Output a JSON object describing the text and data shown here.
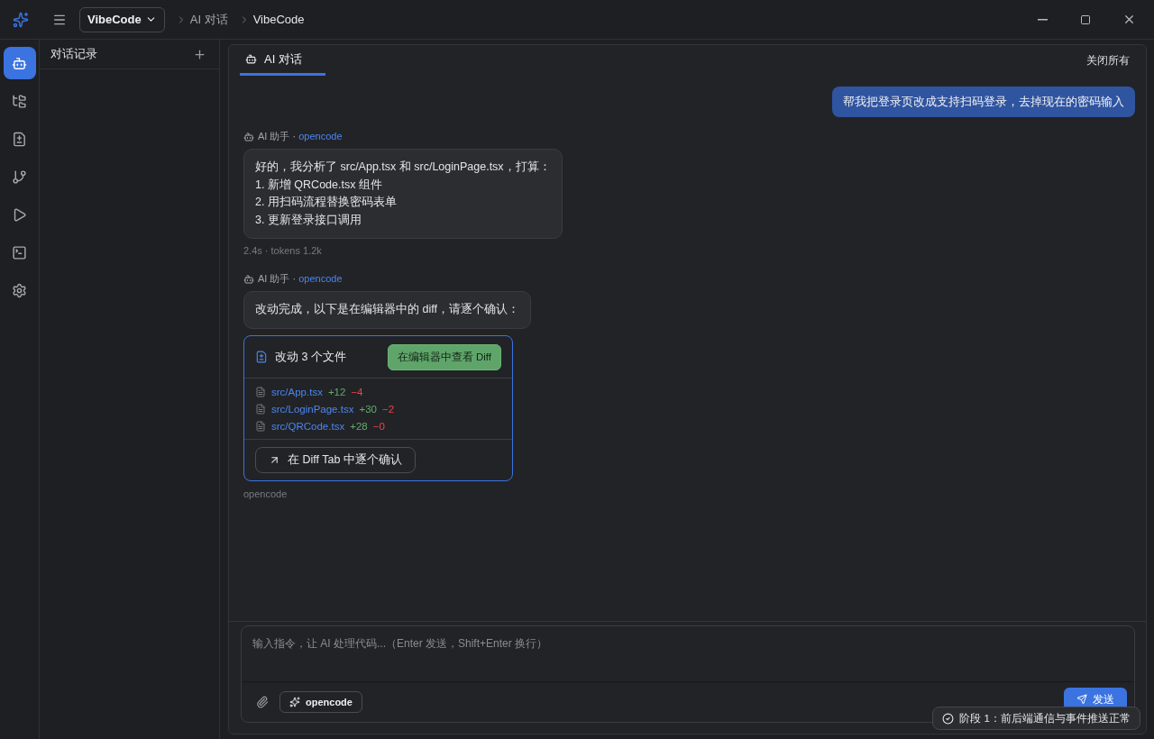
{
  "titlebar": {
    "project": "VibeCode",
    "breadcrumbs": [
      "AI 对话",
      "VibeCode"
    ]
  },
  "activity_bar": [
    {
      "kind": "bot",
      "selected": true
    },
    {
      "kind": "tree",
      "selected": false
    },
    {
      "kind": "diff",
      "selected": false
    },
    {
      "kind": "branch",
      "selected": false
    },
    {
      "kind": "run",
      "selected": false
    },
    {
      "kind": "terminal",
      "selected": false
    },
    {
      "kind": "settings",
      "selected": false
    }
  ],
  "sidebar": {
    "title": "对话记录"
  },
  "tabs": [
    {
      "label": "AI 对话",
      "selected": true
    }
  ],
  "close_all": "关闭所有",
  "messages": [
    {
      "kind": "user",
      "text": "帮我把登录页改成支持扫码登录，去掉现在的密码输入"
    },
    {
      "kind": "assistant",
      "author": "AI 助手 · ",
      "source": "opencode",
      "lines": [
        "好的，我分析了 src/App.tsx 和 src/LoginPage.tsx，打算：",
        "1. 新增 QRCode.tsx 组件",
        "2. 用扫码流程替换密码表单",
        "3. 更新登录接口调用"
      ],
      "meta": "2.4s · tokens 1.2k"
    },
    {
      "kind": "assistant",
      "author": "AI 助手 · ",
      "source": "opencode",
      "lines": [
        "改动完成，以下是在编辑器中的 diff，请逐个确认："
      ],
      "changes": {
        "title": "改动 3 个文件",
        "view_button": "在编辑器中查看 Diff",
        "files": [
          {
            "path": "src/App.tsx",
            "added": "+12",
            "removed": "−4"
          },
          {
            "path": "src/LoginPage.tsx",
            "added": "+30",
            "removed": "−2"
          },
          {
            "path": "src/QRCode.tsx",
            "added": "+28",
            "removed": "−0"
          }
        ],
        "confirm_button": "在 Diff Tab 中逐个确认"
      },
      "meta": "opencode"
    }
  ],
  "composer": {
    "placeholder": "输入指令，让 AI 处理代码...（Enter 发送，Shift+Enter 换行）",
    "agent": "opencode",
    "send": "发送"
  },
  "toast": "阶段 1：前后端通信与事件推送正常"
}
